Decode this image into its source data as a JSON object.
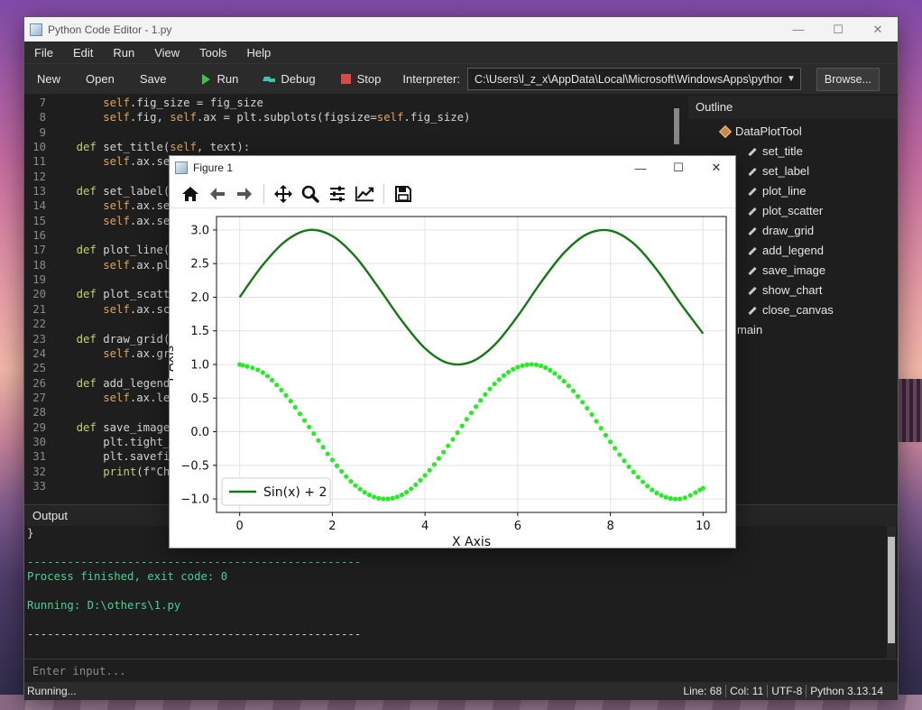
{
  "main_window": {
    "title": "Python Code Editor - 1.py",
    "controls": {
      "minimize": "—",
      "maximize": "☐",
      "close": "✕"
    }
  },
  "menu": [
    "File",
    "Edit",
    "Run",
    "View",
    "Tools",
    "Help"
  ],
  "toolbar": {
    "new": "New",
    "open": "Open",
    "save": "Save",
    "run": "Run",
    "debug": "Debug",
    "stop": "Stop",
    "interpreter_label": "Interpreter:",
    "interpreter_value": "C:\\Users\\l_z_x\\AppData\\Local\\Microsoft\\WindowsApps\\python.exe",
    "browse": "Browse..."
  },
  "editor": {
    "line_numbers": [
      "7",
      "8",
      "9",
      "10",
      "11",
      "12",
      "13",
      "14",
      "15",
      "16",
      "17",
      "18",
      "19",
      "20",
      "21",
      "22",
      "23",
      "24",
      "25",
      "26",
      "27",
      "28",
      "29",
      "30",
      "31",
      "32",
      "33"
    ],
    "lines": [
      [
        [
          "",
          "        "
        ],
        [
          "self",
          "self"
        ],
        [
          "",
          ".fig_size = fig_size"
        ]
      ],
      [
        [
          "",
          "        "
        ],
        [
          "self",
          "self"
        ],
        [
          "",
          ".fig, "
        ],
        [
          "self",
          "self"
        ],
        [
          "",
          ".ax = plt.subplots(figsize="
        ],
        [
          "self",
          "self"
        ],
        [
          "",
          ".fig_size)"
        ]
      ],
      [
        [
          "",
          ""
        ]
      ],
      [
        [
          "",
          "    "
        ],
        [
          "kw",
          "def"
        ],
        [
          "",
          " set_title("
        ],
        [
          "self",
          "self"
        ],
        [
          "",
          ", text):"
        ]
      ],
      [
        [
          "",
          "        "
        ],
        [
          "self",
          "self"
        ],
        [
          "",
          ".ax.se"
        ]
      ],
      [
        [
          "",
          ""
        ]
      ],
      [
        [
          "",
          "    "
        ],
        [
          "kw",
          "def"
        ],
        [
          "",
          " set_label("
        ]
      ],
      [
        [
          "",
          "        "
        ],
        [
          "self",
          "self"
        ],
        [
          "",
          ".ax.se"
        ]
      ],
      [
        [
          "",
          "        "
        ],
        [
          "self",
          "self"
        ],
        [
          "",
          ".ax.se"
        ]
      ],
      [
        [
          "",
          ""
        ]
      ],
      [
        [
          "",
          "    "
        ],
        [
          "kw",
          "def"
        ],
        [
          "",
          " plot_line("
        ]
      ],
      [
        [
          "",
          "        "
        ],
        [
          "self",
          "self"
        ],
        [
          "",
          ".ax.pl"
        ]
      ],
      [
        [
          "",
          ""
        ]
      ],
      [
        [
          "",
          "    "
        ],
        [
          "kw",
          "def"
        ],
        [
          "",
          " plot_scatt"
        ]
      ],
      [
        [
          "",
          "        "
        ],
        [
          "self",
          "self"
        ],
        [
          "",
          ".ax.sc"
        ]
      ],
      [
        [
          "",
          ""
        ]
      ],
      [
        [
          "",
          "    "
        ],
        [
          "kw",
          "def"
        ],
        [
          "",
          " draw_grid("
        ]
      ],
      [
        [
          "",
          "        "
        ],
        [
          "self",
          "self"
        ],
        [
          "",
          ".ax.gr"
        ]
      ],
      [
        [
          "",
          ""
        ]
      ],
      [
        [
          "",
          "    "
        ],
        [
          "kw",
          "def"
        ],
        [
          "",
          " add_legend"
        ]
      ],
      [
        [
          "",
          "        "
        ],
        [
          "self",
          "self"
        ],
        [
          "",
          ".ax.le"
        ]
      ],
      [
        [
          "",
          ""
        ]
      ],
      [
        [
          "",
          "    "
        ],
        [
          "kw",
          "def"
        ],
        [
          "",
          " save_image"
        ]
      ],
      [
        [
          "",
          "        plt.tight_"
        ]
      ],
      [
        [
          "",
          "        plt.savefi"
        ]
      ],
      [
        [
          "",
          "        "
        ],
        [
          "kw",
          "print"
        ],
        [
          "",
          "(f\"Ch"
        ]
      ],
      [
        [
          "",
          ""
        ]
      ]
    ]
  },
  "outline": {
    "header": "Outline",
    "root": "DataPlotTool",
    "methods": [
      "set_title",
      "set_label",
      "plot_line",
      "plot_scatter",
      "draw_grid",
      "add_legend",
      "save_image",
      "show_chart",
      "close_canvas"
    ],
    "extra": "main"
  },
  "output": {
    "header": "Output",
    "lines": [
      {
        "text": "}",
        "color": "white"
      },
      {
        "text": "",
        "color": "white"
      },
      {
        "text": "--------------------------------------------------",
        "color": "green"
      },
      {
        "text": "Process finished, exit code: 0",
        "color": "green"
      },
      {
        "text": "",
        "color": "white"
      },
      {
        "text": "Running: D:\\others\\1.py",
        "color": "green"
      },
      {
        "text": "",
        "color": "white"
      },
      {
        "text": "--------------------------------------------------",
        "color": "white"
      }
    ],
    "input_placeholder": "Enter input..."
  },
  "status": {
    "left": "Running...",
    "line": "Line: 68",
    "col": "Col: 11",
    "encoding": "UTF-8",
    "python": "Python 3.13.14"
  },
  "figure_window": {
    "title": "Figure 1",
    "controls": {
      "minimize": "—",
      "maximize": "☐",
      "close": "✕"
    },
    "tools": [
      "home-icon",
      "back-arrow-icon",
      "forward-arrow-icon",
      "pan-icon",
      "zoom-icon",
      "configure-subplots-icon",
      "edit-axis-icon",
      "save-icon"
    ]
  },
  "chart_data": {
    "type": "line",
    "title": "",
    "xlabel": "X Axis",
    "ylabel": "Y Axis",
    "xlim": [
      -0.5,
      10.5
    ],
    "ylim": [
      -1.2,
      3.2
    ],
    "xticks": [
      0,
      2,
      4,
      6,
      8,
      10
    ],
    "yticks": [
      -1.0,
      -0.5,
      0.0,
      0.5,
      1.0,
      1.5,
      2.0,
      2.5,
      3.0
    ],
    "ytick_labels": [
      "−1.0",
      "−0.5",
      "0.0",
      "0.5",
      "1.0",
      "1.5",
      "2.0",
      "2.5",
      "3.0"
    ],
    "grid": true,
    "legend": {
      "placement": "lower-left",
      "entries": [
        "Sin(x) + 2"
      ]
    },
    "series": [
      {
        "name": "Sin(x) + 2",
        "kind": "line",
        "color": "#117a11",
        "x": [
          0,
          0.5,
          1,
          1.5,
          2,
          2.5,
          3,
          3.5,
          4,
          4.5,
          5,
          5.5,
          6,
          6.5,
          7,
          7.5,
          8,
          8.5,
          9,
          9.5,
          10
        ],
        "y": [
          2.0,
          2.48,
          2.84,
          3.0,
          2.91,
          2.6,
          2.14,
          1.65,
          1.24,
          1.02,
          1.04,
          1.29,
          1.72,
          2.22,
          2.66,
          2.94,
          2.99,
          2.8,
          2.41,
          1.92,
          1.46
        ]
      },
      {
        "kind": "scatter",
        "color": "#22ee22",
        "x": [
          0,
          0.5,
          1,
          1.5,
          2,
          2.5,
          3,
          3.5,
          4,
          4.5,
          5,
          5.5,
          6,
          6.5,
          7,
          7.5,
          8,
          8.5,
          9,
          9.5,
          10
        ],
        "y": [
          1.0,
          0.88,
          0.54,
          0.07,
          -0.42,
          -0.8,
          -0.99,
          -0.94,
          -0.65,
          -0.21,
          0.28,
          0.71,
          0.96,
          0.98,
          0.75,
          0.35,
          -0.15,
          -0.6,
          -0.91,
          -1.0,
          -0.84
        ]
      }
    ]
  }
}
